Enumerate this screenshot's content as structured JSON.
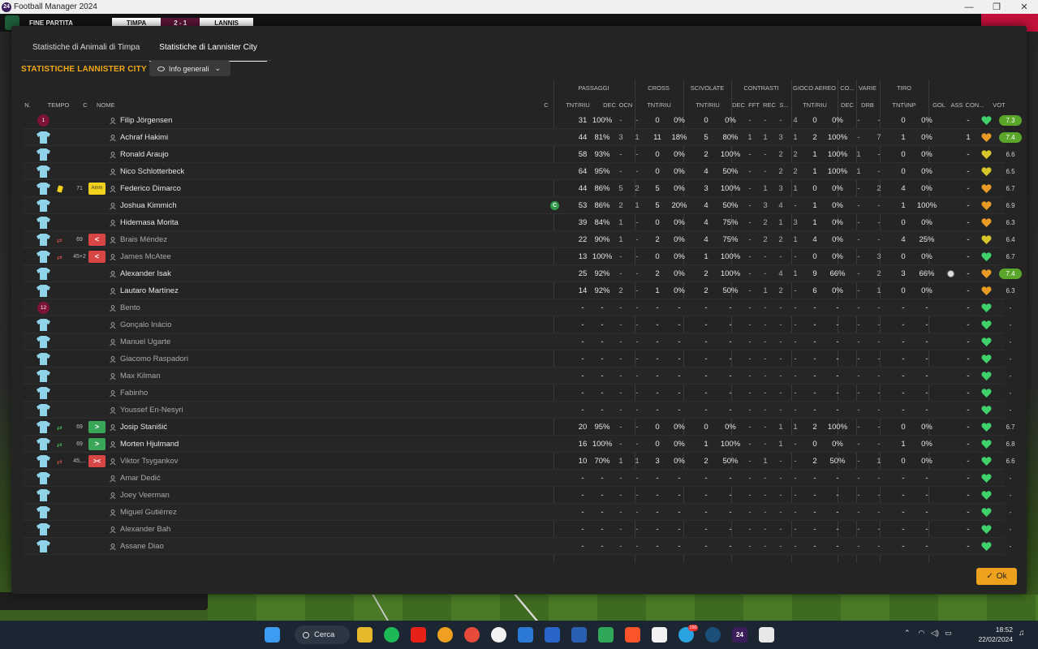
{
  "window": {
    "title": "Football Manager 2024",
    "app_icon": "24"
  },
  "game_strip": {
    "label": "FINE PARTITA",
    "home": "TIMPA",
    "score": "2 - 1",
    "away": "LANNIS"
  },
  "tabs": [
    {
      "label": "Statistiche di Animali di Timpa",
      "active": false
    },
    {
      "label": "Statistiche di Lannister City",
      "active": true
    }
  ],
  "section_title": "STATISTICHE LANNISTER CITY",
  "view_select": {
    "value": "Info generali"
  },
  "headers": {
    "num": "N.",
    "tempo": "TEMPO",
    "c": "C",
    "nome": "NOME",
    "c2": "C",
    "groups": {
      "passaggi": "PASSAGGI",
      "cross": "CROSS",
      "scivolate": "SCIVOLATE",
      "contrasti": "CONTRASTI",
      "gioco_aereo": "GIOCO AEREO",
      "co": "CO...",
      "varie": "VARIE",
      "tiro": "TIRO"
    },
    "cols": {
      "pas_tnt": "TNT/RIU",
      "dec": "DEC",
      "ocn": "OCN",
      "cross_tnt": "TNT/RIU",
      "sciv_tnt": "TNT/RIU",
      "con_dec": "DEC",
      "fft": "FFT",
      "rec": "REC",
      "s": "S...",
      "aereo_tnt": "TNT/RIU",
      "co_dec": "DEC",
      "drb": "DRB",
      "tiro_tnt": "TNT\\INP",
      "gol": "GOL",
      "ass": "ASS",
      "con": "CON...",
      "vot": "VOT"
    }
  },
  "players": [
    {
      "badge": "1",
      "name": "Filip Jörgensen",
      "cap": false,
      "time": "",
      "card": false,
      "cbadge": "",
      "sub": "",
      "p1": "31",
      "p2": "100%",
      "dec": "-",
      "ocn": "-",
      "cr1": "0",
      "cr2": "0%",
      "sc1": "0",
      "sc2": "0%",
      "cd": "-",
      "fft": "-",
      "rec": "-",
      "s": "4",
      "ga1": "0",
      "ga2": "0%",
      "cod": "-",
      "drb": "-",
      "t1": "0",
      "t2": "0%",
      "gol": "",
      "ass": "-",
      "heart": "green",
      "vot": "7.3",
      "hi": true,
      "used": true
    },
    {
      "badge": "",
      "name": "Achraf Hakimi",
      "cap": false,
      "time": "",
      "card": false,
      "cbadge": "",
      "sub": "",
      "p1": "44",
      "p2": "81%",
      "dec": "3",
      "ocn": "1",
      "cr1": "11",
      "cr2": "18%",
      "sc1": "5",
      "sc2": "80%",
      "cd": "1",
      "fft": "1",
      "rec": "3",
      "s": "1",
      "ga1": "2",
      "ga2": "100%",
      "cod": "-",
      "drb": "7",
      "t1": "1",
      "t2": "0%",
      "gol": "",
      "ass": "1",
      "heart": "orange",
      "vot": "7.4",
      "hi": true,
      "used": true
    },
    {
      "badge": "",
      "name": "Ronald Araujo",
      "cap": false,
      "time": "",
      "card": false,
      "cbadge": "",
      "sub": "",
      "p1": "58",
      "p2": "93%",
      "dec": "-",
      "ocn": "-",
      "cr1": "0",
      "cr2": "0%",
      "sc1": "2",
      "sc2": "100%",
      "cd": "-",
      "fft": "-",
      "rec": "2",
      "s": "2",
      "ga1": "1",
      "ga2": "100%",
      "cod": "1",
      "drb": "-",
      "t1": "0",
      "t2": "0%",
      "gol": "",
      "ass": "-",
      "heart": "yellow",
      "vot": "6.6",
      "hi": false,
      "used": true
    },
    {
      "badge": "",
      "name": "Nico Schlotterbeck",
      "cap": false,
      "time": "",
      "card": false,
      "cbadge": "",
      "sub": "",
      "p1": "64",
      "p2": "95%",
      "dec": "-",
      "ocn": "-",
      "cr1": "0",
      "cr2": "0%",
      "sc1": "4",
      "sc2": "50%",
      "cd": "-",
      "fft": "-",
      "rec": "2",
      "s": "2",
      "ga1": "1",
      "ga2": "100%",
      "cod": "1",
      "drb": "-",
      "t1": "0",
      "t2": "0%",
      "gol": "",
      "ass": "-",
      "heart": "yellow",
      "vot": "6.5",
      "hi": false,
      "used": true
    },
    {
      "badge": "",
      "name": "Federico Dimarco",
      "cap": false,
      "time": "71",
      "card": true,
      "cbadge": "Amm",
      "sub": "",
      "p1": "44",
      "p2": "86%",
      "dec": "5",
      "ocn": "2",
      "cr1": "5",
      "cr2": "0%",
      "sc1": "3",
      "sc2": "100%",
      "cd": "-",
      "fft": "1",
      "rec": "3",
      "s": "1",
      "ga1": "0",
      "ga2": "0%",
      "cod": "-",
      "drb": "2",
      "t1": "4",
      "t2": "0%",
      "gol": "",
      "ass": "-",
      "heart": "orange",
      "vot": "6.7",
      "hi": false,
      "used": true
    },
    {
      "badge": "",
      "name": "Joshua Kimmich",
      "cap": true,
      "time": "",
      "card": false,
      "cbadge": "",
      "sub": "",
      "p1": "53",
      "p2": "86%",
      "dec": "2",
      "ocn": "1",
      "cr1": "5",
      "cr2": "20%",
      "sc1": "4",
      "sc2": "50%",
      "cd": "-",
      "fft": "3",
      "rec": "4",
      "s": "-",
      "ga1": "1",
      "ga2": "0%",
      "cod": "-",
      "drb": "-",
      "t1": "1",
      "t2": "100%",
      "gol": "",
      "ass": "-",
      "heart": "orange",
      "vot": "6.9",
      "hi": false,
      "used": true
    },
    {
      "badge": "",
      "name": "Hidemasa Morita",
      "cap": false,
      "time": "",
      "card": false,
      "cbadge": "",
      "sub": "",
      "p1": "39",
      "p2": "84%",
      "dec": "1",
      "ocn": "-",
      "cr1": "0",
      "cr2": "0%",
      "sc1": "4",
      "sc2": "75%",
      "cd": "-",
      "fft": "2",
      "rec": "1",
      "s": "3",
      "ga1": "1",
      "ga2": "0%",
      "cod": "-",
      "drb": "-",
      "t1": "0",
      "t2": "0%",
      "gol": "",
      "ass": "-",
      "heart": "orange",
      "vot": "6.3",
      "hi": false,
      "used": true
    },
    {
      "badge": "",
      "name": "Brais Méndez",
      "cap": false,
      "time": "69",
      "card": false,
      "cbadge": "<",
      "sub": "out",
      "p1": "22",
      "p2": "90%",
      "dec": "1",
      "ocn": "-",
      "cr1": "2",
      "cr2": "0%",
      "sc1": "4",
      "sc2": "75%",
      "cd": "-",
      "fft": "2",
      "rec": "2",
      "s": "1",
      "ga1": "4",
      "ga2": "0%",
      "cod": "-",
      "drb": "-",
      "t1": "4",
      "t2": "25%",
      "gol": "",
      "ass": "-",
      "heart": "yellow",
      "vot": "6.4",
      "hi": false,
      "used": false
    },
    {
      "badge": "",
      "name": "James McAtee",
      "cap": false,
      "time": "45+2",
      "card": false,
      "cbadge": "<",
      "sub": "out",
      "p1": "13",
      "p2": "100%",
      "dec": "-",
      "ocn": "-",
      "cr1": "0",
      "cr2": "0%",
      "sc1": "1",
      "sc2": "100%",
      "cd": "-",
      "fft": "-",
      "rec": "-",
      "s": "-",
      "ga1": "0",
      "ga2": "0%",
      "cod": "-",
      "drb": "3",
      "t1": "0",
      "t2": "0%",
      "gol": "",
      "ass": "-",
      "heart": "green",
      "vot": "6.7",
      "hi": false,
      "used": false
    },
    {
      "badge": "",
      "name": "Alexander Isak",
      "cap": false,
      "time": "",
      "card": false,
      "cbadge": "",
      "sub": "",
      "p1": "25",
      "p2": "92%",
      "dec": "-",
      "ocn": "-",
      "cr1": "2",
      "cr2": "0%",
      "sc1": "2",
      "sc2": "100%",
      "cd": "-",
      "fft": "-",
      "rec": "4",
      "s": "1",
      "ga1": "9",
      "ga2": "66%",
      "cod": "-",
      "drb": "2",
      "t1": "3",
      "t2": "66%",
      "gol": "ball",
      "ass": "-",
      "heart": "orange",
      "vot": "7.4",
      "hi": true,
      "used": true
    },
    {
      "badge": "",
      "name": "Lautaro Martínez",
      "cap": false,
      "time": "",
      "card": false,
      "cbadge": "",
      "sub": "",
      "p1": "14",
      "p2": "92%",
      "dec": "2",
      "ocn": "-",
      "cr1": "1",
      "cr2": "0%",
      "sc1": "2",
      "sc2": "50%",
      "cd": "-",
      "fft": "1",
      "rec": "2",
      "s": "-",
      "ga1": "6",
      "ga2": "0%",
      "cod": "-",
      "drb": "1",
      "t1": "0",
      "t2": "0%",
      "gol": "",
      "ass": "-",
      "heart": "orange",
      "vot": "6.3",
      "hi": false,
      "used": true
    },
    {
      "badge": "12",
      "name": "Bento",
      "cap": false,
      "time": "",
      "card": false,
      "cbadge": "",
      "sub": "",
      "empty": true,
      "heart": "green",
      "vot": "-",
      "hi": false,
      "used": false
    },
    {
      "badge": "",
      "name": "Gonçalo Inácio",
      "empty": true,
      "heart": "green",
      "vot": "-",
      "used": false
    },
    {
      "badge": "",
      "name": "Manuel Ugarte",
      "empty": true,
      "heart": "green",
      "vot": "-",
      "used": false
    },
    {
      "badge": "",
      "name": "Giacomo Raspadori",
      "empty": true,
      "heart": "green",
      "vot": "-",
      "used": false
    },
    {
      "badge": "",
      "name": "Max Kilman",
      "empty": true,
      "heart": "green",
      "vot": "-",
      "used": false
    },
    {
      "badge": "",
      "name": "Fabinho",
      "empty": true,
      "heart": "green",
      "vot": "-",
      "used": false
    },
    {
      "badge": "",
      "name": "Youssef En-Nesyri",
      "empty": true,
      "heart": "green",
      "vot": "-",
      "used": false
    },
    {
      "badge": "",
      "name": "Josip Stanišić",
      "cap": false,
      "time": "69",
      "card": false,
      "cbadge": ">",
      "sub": "in",
      "p1": "20",
      "p2": "95%",
      "dec": "-",
      "ocn": "-",
      "cr1": "0",
      "cr2": "0%",
      "sc1": "0",
      "sc2": "0%",
      "cd": "-",
      "fft": "-",
      "rec": "1",
      "s": "1",
      "ga1": "2",
      "ga2": "100%",
      "cod": "-",
      "drb": "-",
      "t1": "0",
      "t2": "0%",
      "gol": "",
      "ass": "-",
      "heart": "green",
      "vot": "6.7",
      "hi": false,
      "used": true
    },
    {
      "badge": "",
      "name": "Morten Hjulmand",
      "cap": false,
      "time": "69",
      "card": false,
      "cbadge": ">",
      "sub": "in",
      "p1": "16",
      "p2": "100%",
      "dec": "-",
      "ocn": "-",
      "cr1": "0",
      "cr2": "0%",
      "sc1": "1",
      "sc2": "100%",
      "cd": "-",
      "fft": "-",
      "rec": "1",
      "s": "-",
      "ga1": "0",
      "ga2": "0%",
      "cod": "-",
      "drb": "-",
      "t1": "1",
      "t2": "0%",
      "gol": "",
      "ass": "-",
      "heart": "green",
      "vot": "6.8",
      "hi": false,
      "used": true
    },
    {
      "badge": "",
      "name": "Viktor Tsygankov",
      "cap": false,
      "time": "45,...",
      "card": false,
      "cbadge": "><",
      "sub": "both",
      "p1": "10",
      "p2": "70%",
      "dec": "1",
      "ocn": "1",
      "cr1": "3",
      "cr2": "0%",
      "sc1": "2",
      "sc2": "50%",
      "cd": "-",
      "fft": "1",
      "rec": "-",
      "s": "-",
      "ga1": "2",
      "ga2": "50%",
      "cod": "-",
      "drb": "1",
      "t1": "0",
      "t2": "0%",
      "gol": "",
      "ass": "-",
      "heart": "green",
      "vot": "6.6",
      "hi": false,
      "used": false
    },
    {
      "badge": "",
      "name": "Amar Dedić",
      "empty": true,
      "heart": "green",
      "vot": "-",
      "used": false
    },
    {
      "badge": "",
      "name": "Joey Veerman",
      "empty": true,
      "heart": "green",
      "vot": "-",
      "used": false
    },
    {
      "badge": "",
      "name": "Miguel Gutiérrez",
      "empty": true,
      "heart": "green",
      "vot": "-",
      "used": false
    },
    {
      "badge": "",
      "name": "Alexander Bah",
      "empty": true,
      "heart": "green",
      "vot": "-",
      "used": false
    },
    {
      "badge": "",
      "name": "Assane Diao",
      "empty": true,
      "heart": "green",
      "vot": "-",
      "used": false
    }
  ],
  "ok_button": "Ok",
  "taskbar": {
    "search": "Cerca",
    "telegram_badge": "150",
    "fm_label": "24",
    "time": "18:52",
    "date": "22/02/2024"
  },
  "colors": {
    "accent": "#f0a818",
    "ok": "#eea11e",
    "rating_high": "#5aa62a",
    "heart_green": "#3fd16a",
    "heart_orange": "#e89a24",
    "heart_yellow": "#d8c52a"
  }
}
